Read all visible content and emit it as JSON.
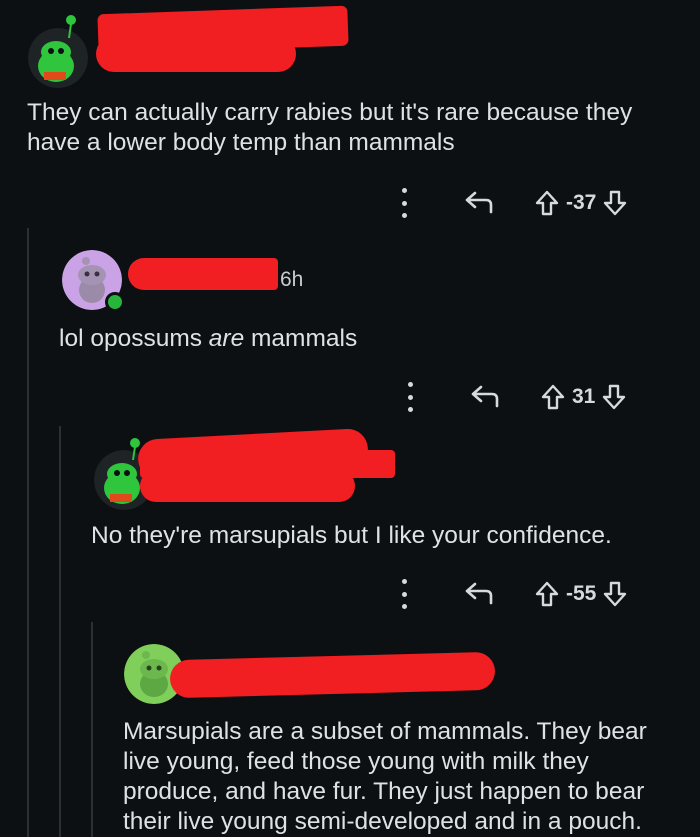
{
  "comments": [
    {
      "body": "They can actually carry rabies but it's rare because they have a lower body temp than mammals",
      "score": "-37",
      "icons": {
        "more": "more-vertical-icon",
        "reply": "reply-arrow-icon",
        "upvote": "upvote-arrow-icon",
        "downvote": "downvote-arrow-icon"
      }
    },
    {
      "time": "6h",
      "body_pre": "lol opossums ",
      "body_em": "are",
      "body_post": " mammals",
      "score": "31",
      "icons": {
        "more": "more-vertical-icon",
        "reply": "reply-arrow-icon",
        "upvote": "upvote-arrow-icon",
        "downvote": "downvote-arrow-icon"
      }
    },
    {
      "body": "No they're marsupials but I like your confidence.",
      "score": "-55",
      "icons": {
        "more": "more-vertical-icon",
        "reply": "reply-arrow-icon",
        "upvote": "upvote-arrow-icon",
        "downvote": "downvote-arrow-icon"
      }
    },
    {
      "body": "Marsupials are a subset of mammals. They bear live young, feed those young with milk they produce, and have fur. They just happen to bear their live young semi-developed and in a pouch."
    }
  ],
  "colors": {
    "background": "#0d1012",
    "text": "#dfe2e4",
    "redaction": "#f21f22",
    "avatar_green": "#2fc53c",
    "avatar_purple": "#c9a3e6",
    "online_dot": "#27b53c"
  }
}
